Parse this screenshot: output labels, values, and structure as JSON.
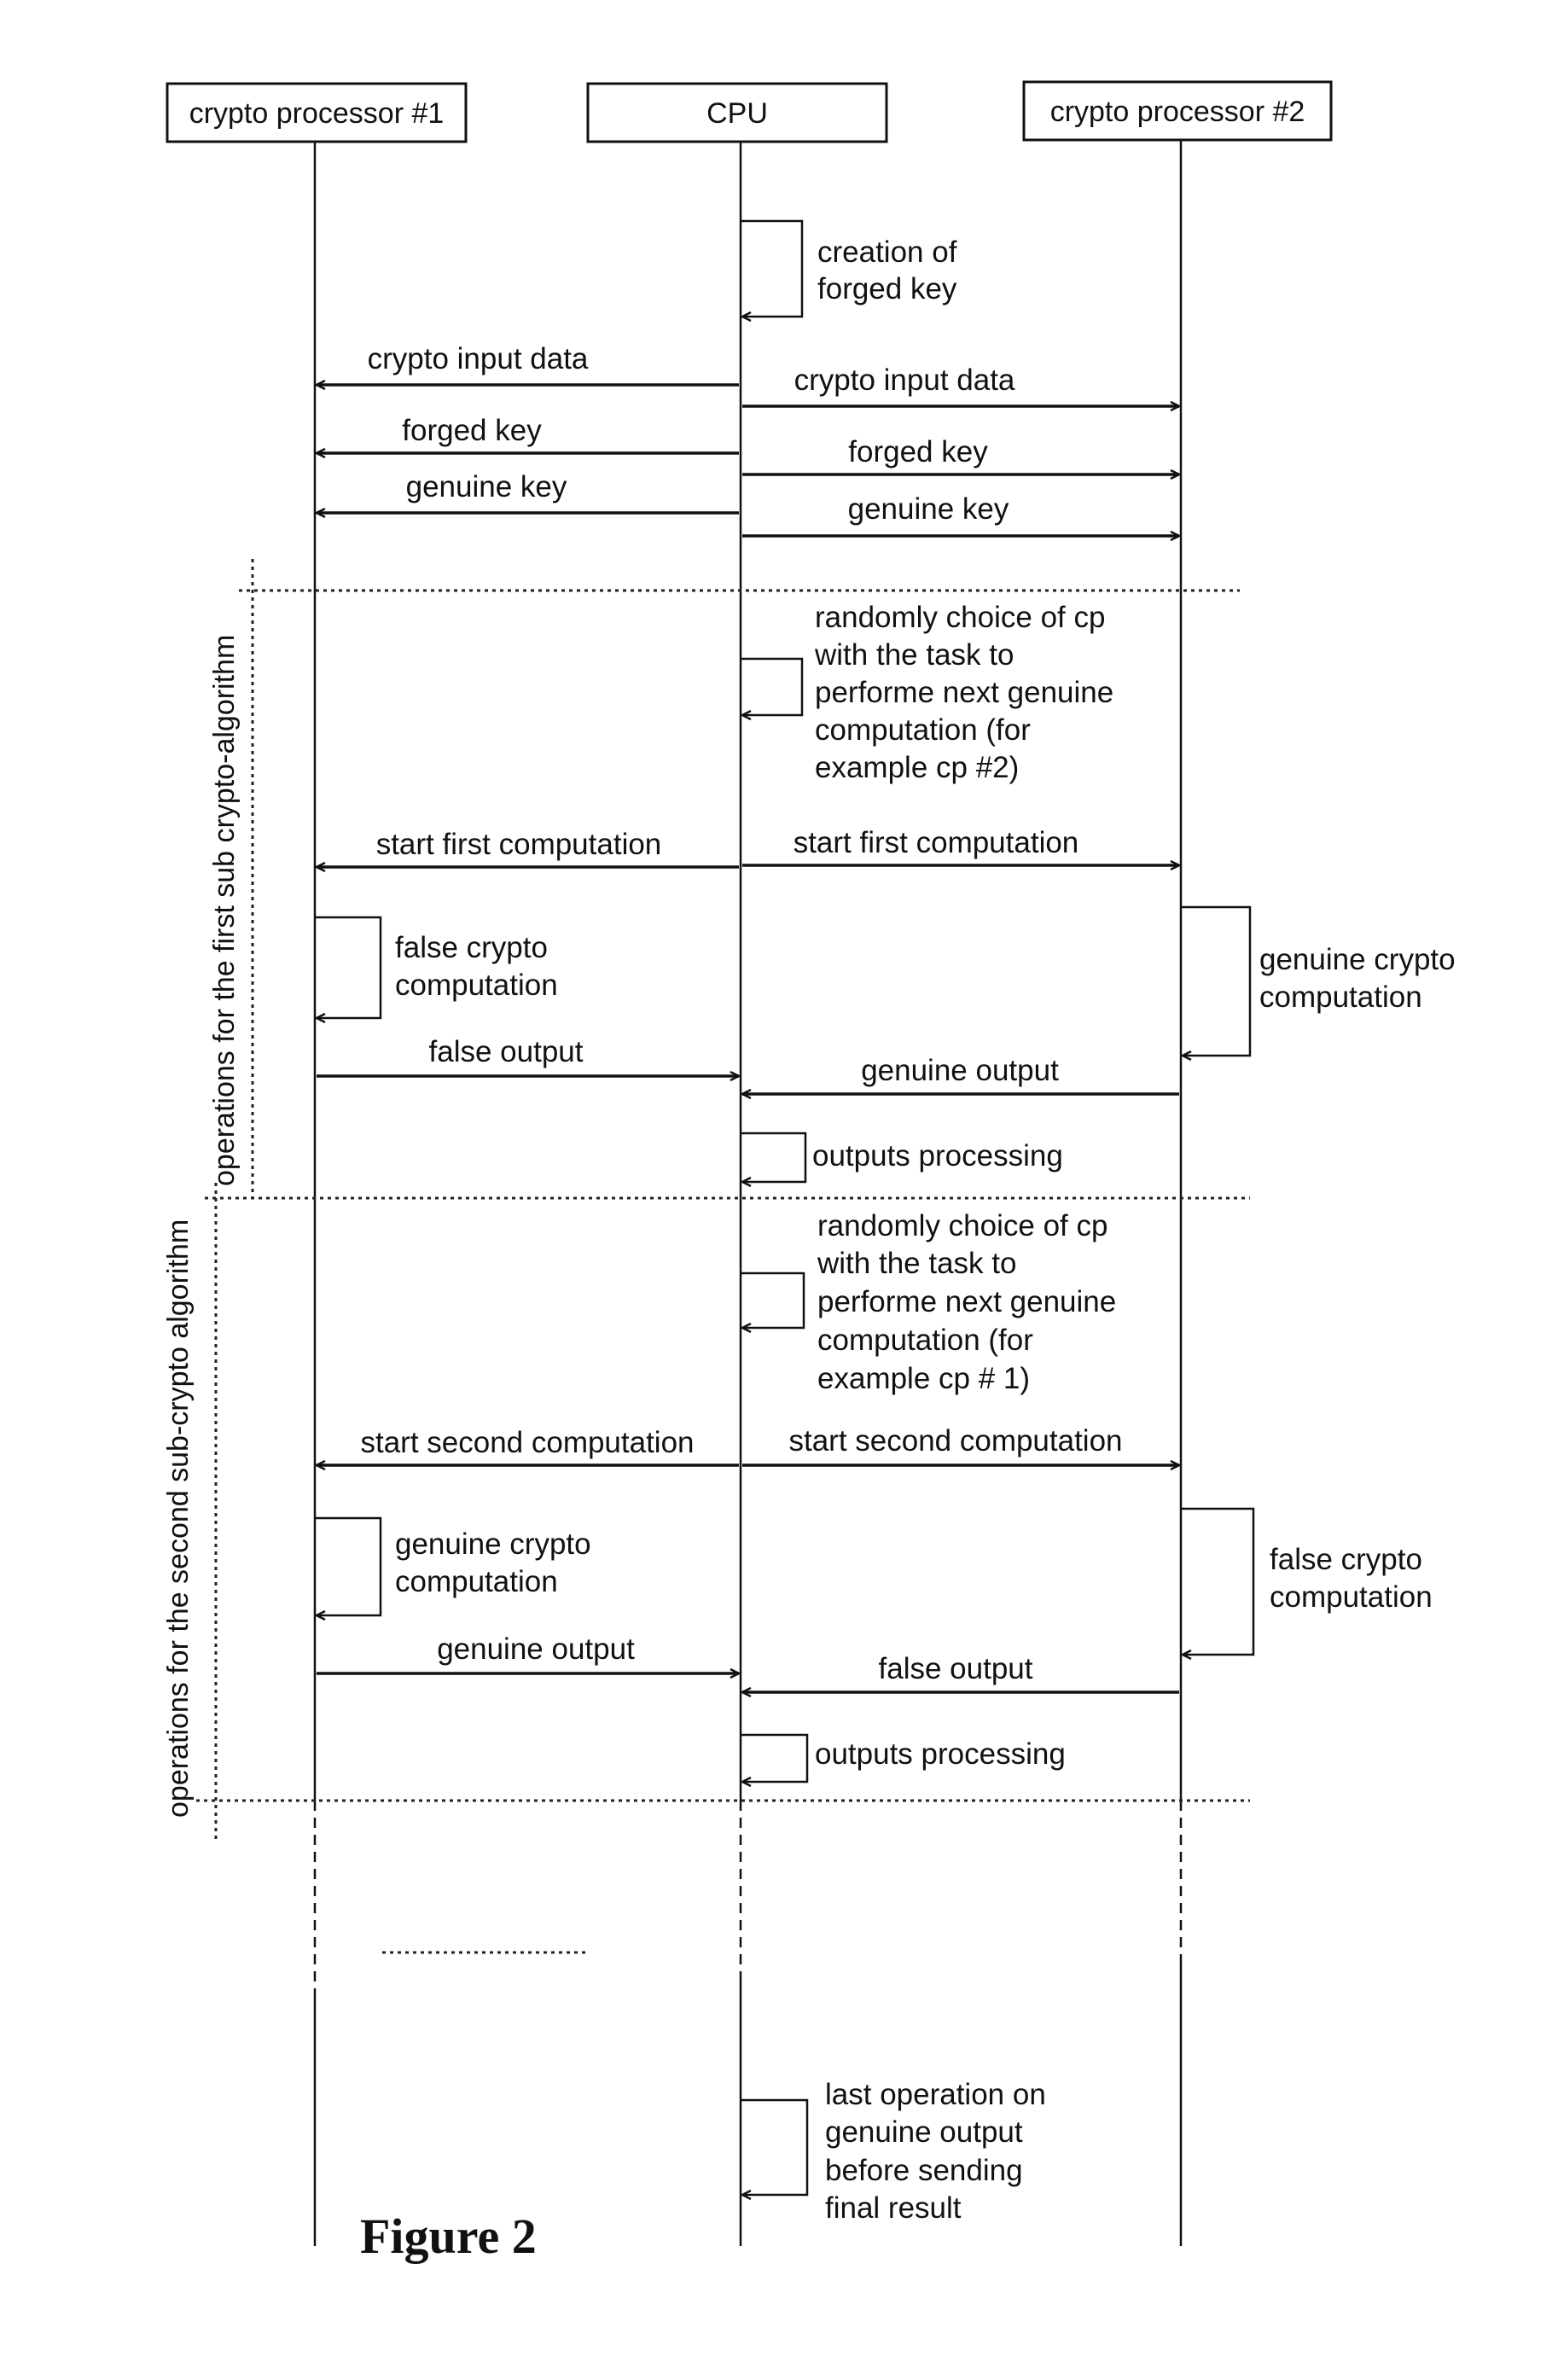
{
  "figure_title": "Figure 2",
  "participants": {
    "cp1": "crypto processor #1",
    "cpu": "CPU",
    "cp2": "crypto processor #2"
  },
  "groups": {
    "first": "operations for the first sub crypto-algorithm",
    "second": "operations for the second sub-crypto algorithm"
  },
  "messages": {
    "creation_forged_key": [
      "creation of",
      "forged key"
    ],
    "crypto_input_cp1": "crypto input data",
    "crypto_input_cp2": "crypto input data",
    "forged_key_cp1": "forged key",
    "forged_key_cp2": "forged key",
    "genuine_key_cp1": "genuine key",
    "genuine_key_cp2": "genuine key",
    "random_choice_1": [
      "randomly choice of cp",
      "with the task to",
      "performe next genuine",
      "computation (for",
      "example cp #2)"
    ],
    "start_first_cp1": "start first computation",
    "start_first_cp2": "start first computation",
    "false_crypto_1": [
      "false crypto",
      "computation"
    ],
    "genuine_crypto_1": [
      "genuine crypto",
      "computation"
    ],
    "false_output_1": "false output",
    "genuine_output_1": "genuine output",
    "outputs_processing_1": "outputs processing",
    "random_choice_2": [
      "randomly choice of cp",
      "with the task to",
      "performe next genuine",
      "computation (for",
      "example cp # 1)"
    ],
    "start_second_cp1": "start second computation",
    "start_second_cp2": "start second computation",
    "genuine_crypto_2": [
      "genuine crypto",
      "computation"
    ],
    "false_crypto_2": [
      "false crypto",
      "computation"
    ],
    "genuine_output_2": "genuine output",
    "false_output_2": "false output",
    "outputs_processing_2": "outputs processing",
    "last_operation": [
      "last operation on",
      "genuine output",
      "before sending",
      "final result"
    ]
  }
}
